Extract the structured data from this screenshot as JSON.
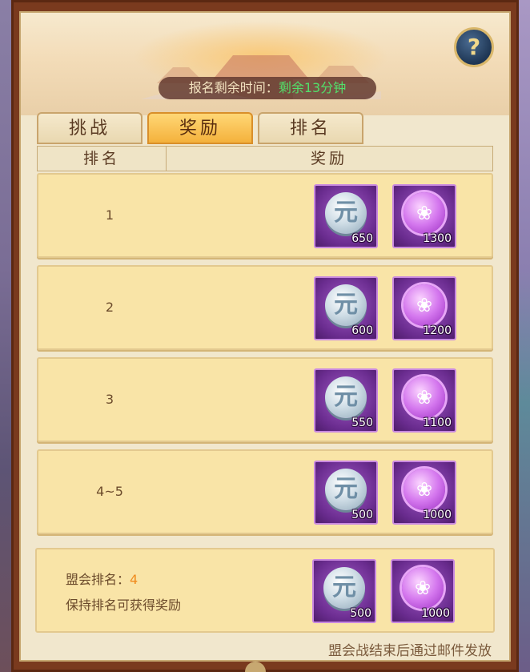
{
  "banner": {
    "timer_label": "报名剩余时间：",
    "timer_prefix": "剩余",
    "timer_value": "13",
    "timer_unit": "分钟"
  },
  "help_button": {
    "label": "?"
  },
  "tabs": [
    {
      "label": "挑战",
      "active": false
    },
    {
      "label": "奖励",
      "active": true
    },
    {
      "label": "排名",
      "active": false
    }
  ],
  "table": {
    "headers": {
      "rank": "排名",
      "reward": "奖励"
    },
    "rows": [
      {
        "rank": "1",
        "rewards": [
          {
            "icon": "silver-coin-icon",
            "qty": "650"
          },
          {
            "icon": "purple-token-icon",
            "qty": "1300"
          }
        ]
      },
      {
        "rank": "2",
        "rewards": [
          {
            "icon": "silver-coin-icon",
            "qty": "600"
          },
          {
            "icon": "purple-token-icon",
            "qty": "1200"
          }
        ]
      },
      {
        "rank": "3",
        "rewards": [
          {
            "icon": "silver-coin-icon",
            "qty": "550"
          },
          {
            "icon": "purple-token-icon",
            "qty": "1100"
          }
        ]
      },
      {
        "rank": "4~5",
        "rewards": [
          {
            "icon": "silver-coin-icon",
            "qty": "500"
          },
          {
            "icon": "purple-token-icon",
            "qty": "1000"
          }
        ]
      }
    ]
  },
  "my_rank": {
    "label": "盟会排名：",
    "value": "4",
    "hint": "保持排名可获得奖励",
    "rewards": [
      {
        "icon": "silver-coin-icon",
        "qty": "500"
      },
      {
        "icon": "purple-token-icon",
        "qty": "1000"
      }
    ]
  },
  "footer_note": "盟会战结束后通过邮件发放",
  "colors": {
    "frame": "#7a3a1e",
    "panel": "#f1e7cd",
    "row_bg": "#f9e4a7",
    "active_tab": "#f4b13c",
    "timer_green": "#52e06a",
    "rank_orange": "#f08a1c",
    "item_purple": "#6a2c8f"
  }
}
